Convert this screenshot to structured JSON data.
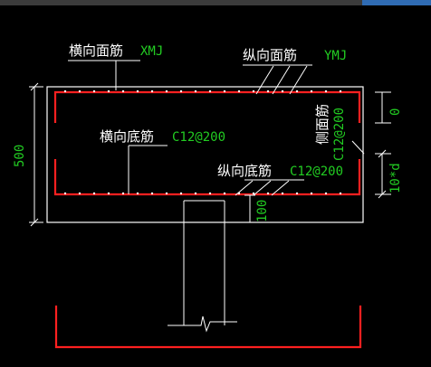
{
  "labels": {
    "transverse_top_cn": "横向面筋",
    "transverse_top_code": "XMJ",
    "longitudinal_top_cn": "纵向面筋",
    "longitudinal_top_code": "YMJ",
    "transverse_bottom_cn": "横向底筋",
    "transverse_bottom_spec": "C12@200",
    "longitudinal_bottom_cn": "纵向底筋",
    "longitudinal_bottom_spec": "C12@200",
    "side_cn": "侧面筋",
    "side_spec": "C12@200"
  },
  "dimensions": {
    "height": "500",
    "bottom_cover": "100",
    "side_offset": "0",
    "anchorage": "10*d"
  },
  "colors": {
    "background": "#000000",
    "outline": "#ffffff",
    "rebar": "#ff2020",
    "annotation_text": "#ffffff",
    "spec_text": "#22cc22"
  }
}
